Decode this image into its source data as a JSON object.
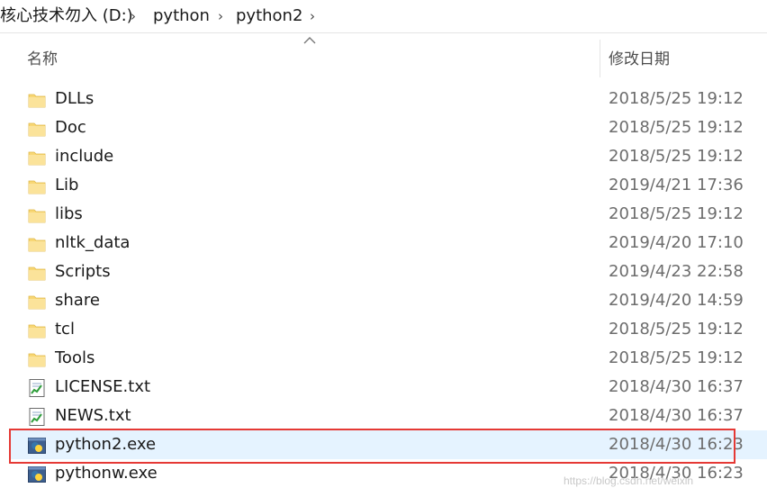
{
  "breadcrumb": {
    "drive": "核心技术勿入 (D:)",
    "folder1": "python",
    "folder2": "python2",
    "separator": "›"
  },
  "columns": {
    "name": "名称",
    "date": "修改日期"
  },
  "files": [
    {
      "name": "DLLs",
      "date": "2018/5/25 19:12",
      "icon": "folder-icon"
    },
    {
      "name": "Doc",
      "date": "2018/5/25 19:12",
      "icon": "folder-icon"
    },
    {
      "name": "include",
      "date": "2018/5/25 19:12",
      "icon": "folder-icon"
    },
    {
      "name": "Lib",
      "date": "2019/4/21 17:36",
      "icon": "folder-icon"
    },
    {
      "name": "libs",
      "date": "2018/5/25 19:12",
      "icon": "folder-icon"
    },
    {
      "name": "nltk_data",
      "date": "2019/4/20 17:10",
      "icon": "folder-icon"
    },
    {
      "name": "Scripts",
      "date": "2019/4/23 22:58",
      "icon": "folder-icon"
    },
    {
      "name": "share",
      "date": "2019/4/20 14:59",
      "icon": "folder-icon"
    },
    {
      "name": "tcl",
      "date": "2018/5/25 19:12",
      "icon": "folder-icon"
    },
    {
      "name": "Tools",
      "date": "2018/5/25 19:12",
      "icon": "folder-icon"
    },
    {
      "name": "LICENSE.txt",
      "date": "2018/4/30 16:37",
      "icon": "text-file-icon"
    },
    {
      "name": "NEWS.txt",
      "date": "2018/4/30 16:37",
      "icon": "text-file-icon"
    },
    {
      "name": "python2.exe",
      "date": "2018/4/30 16:23",
      "icon": "python-exe-icon"
    },
    {
      "name": "pythonw.exe",
      "date": "2018/4/30 16:23",
      "icon": "python-exe-icon"
    }
  ],
  "selected_file": "python2.exe",
  "colors": {
    "selection": "#e5f3ff",
    "highlight": "#e53935",
    "folder": "#f8d775"
  },
  "watermark": "https://blog.csdn.net/weixin"
}
